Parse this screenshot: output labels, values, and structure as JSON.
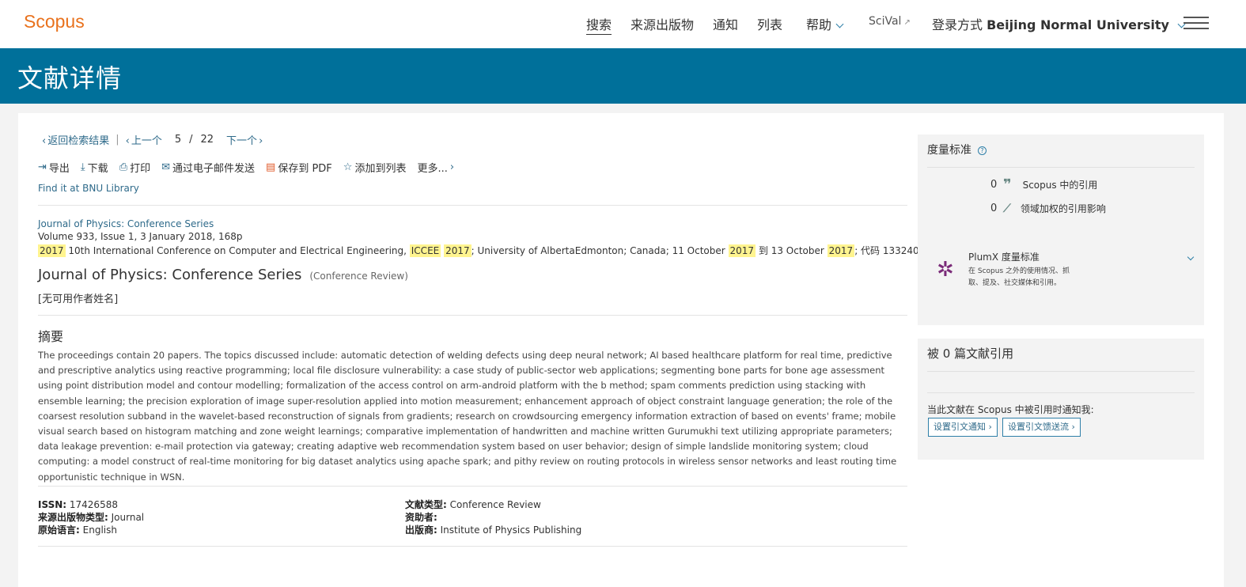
{
  "header": {
    "logo": "Scopus",
    "nav": {
      "search": "搜索",
      "sources": "来源出版物",
      "alerts": "通知",
      "lists": "列表",
      "help": "帮助",
      "scival": "SciVal",
      "scival_arrow": "↗",
      "login_prefix": "登录方式",
      "institution": "Beijing Normal University"
    }
  },
  "page_title": "文献详情",
  "pager": {
    "back": "返回检索结果",
    "prev": "上一个",
    "current": "5",
    "slash": "/",
    "total": "22",
    "next": "下一个"
  },
  "actions": {
    "export": "导出",
    "download": "下载",
    "print": "打印",
    "email": "通过电子邮件发送",
    "pdf": "保存到 PDF",
    "add_list": "添加到列表",
    "more": "更多..."
  },
  "library_link": "Find it at BNU Library",
  "source": {
    "journal": "Journal of Physics: Conference Series",
    "volume": "Volume 933, Issue 1, 3 January 2018, 168p",
    "conf": {
      "y1": "2017",
      "t1": " 10th International Conference on Computer and Electrical Engineering, ",
      "acr": "ICCEE",
      "y2": "2017",
      "t2": "; University of AlbertaEdmonton; Canada; 11 October ",
      "y3": "2017",
      "t3": " 到 13 October ",
      "y4": "2017",
      "t4": "; 代码 133240"
    }
  },
  "document": {
    "title": "Journal of Physics: Conference Series",
    "type_label": "(Conference Review)",
    "no_author": "[无可用作者姓名]"
  },
  "abstract": {
    "heading": "摘要",
    "text": "The proceedings contain 20 papers. The topics discussed include: automatic detection of welding defects using deep neural network; AI based healthcare platform for real time, predictive and prescriptive analytics using reactive programming; local file disclosure vulnerability: a case study of public-sector web applications; segmenting bone parts for bone age assessment using point distribution model and contour modelling; formalization of the access control on arm-android platform with the b method; spam comments prediction using stacking with ensemble learning; the precision exploration of image super-resolution applied into motion measurement; enhancement approach of object constraint language generation; the role of the coarsest resolution subband in the wavelet-based reconstruction of signals from gradients; research on crowdsourcing emergency information extraction of based on events' frame; mobile visual search based on histogram matching and zone weight learnings; comparative implementation of handwritten and machine written Gurumukhi text utilizing appropriate parameters; data leakage prevention: e-mail protection via gateway; creating adaptive web recommendation system based on user behavior; design of simple landslide monitoring system; cloud computing: a model construct of real-time monitoring for big dataset analytics using apache spark; and pithy review on routing protocols in wireless sensor networks and least routing time opportunistic technique in WSN."
  },
  "meta": {
    "issn_label": "ISSN:",
    "issn": "17426588",
    "source_type_label": "来源出版物类型:",
    "source_type": "Journal",
    "language_label": "原始语言:",
    "language": "English",
    "doc_type_label": "文献类型:",
    "doc_type": "Conference Review",
    "sponsor_label": "资助者:",
    "sponsor": "",
    "publisher_label": "出版商:",
    "publisher": "Institute of Physics Publishing"
  },
  "metrics": {
    "title": "度量标准",
    "citations_count": "0",
    "citations_label": "Scopus 中的引用",
    "fwci_count": "0",
    "fwci_label": "领域加权的引用影响",
    "plumx_title": "PlumX 度量标准",
    "plumx_desc": "在 Scopus 之外的使用情况、抓取、提及、社交媒体和引用。"
  },
  "cited_by": {
    "title": "被 0 篇文献引用",
    "notify_text": "当此文献在 Scopus 中被引用时通知我:",
    "alert_button": "设置引文通知 ›",
    "feed_button": "设置引文馈送流 ›"
  },
  "icons": {
    "export": "export-icon",
    "download": "download-icon",
    "print": "print-icon",
    "email": "email-icon",
    "pdf": "pdf-icon",
    "star": "star-icon",
    "quote": "quote-icon",
    "fwci": "fwci-icon",
    "plumx": "plumx-icon"
  },
  "colors": {
    "brand": "#e9711c",
    "band": "#00709a",
    "link": "#2e6a8a",
    "highlight": "#fff48f",
    "plumx": "#7a2a78"
  }
}
